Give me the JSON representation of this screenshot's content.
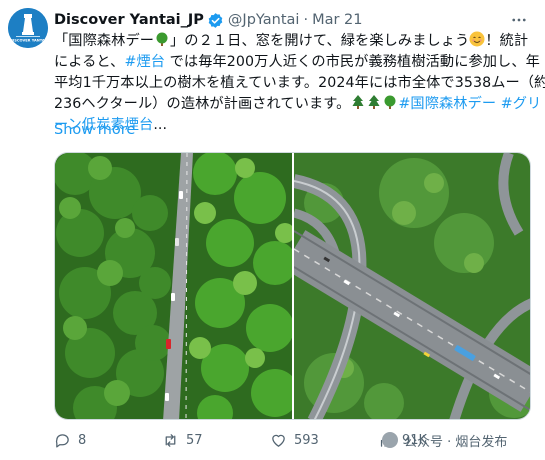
{
  "tweet": {
    "display_name": "Discover Yantai_JP",
    "handle": "@JpYantai",
    "separator": "·",
    "time": "Mar 21",
    "avatar_label": "DISCOVER YANTAI",
    "lines": [
      [
        "「国際森林デー",
        "」の２１日、窓を開けて、緑を楽しみましょう",
        "！統計"
      ],
      [
        "によると、",
        "#煙台",
        " では毎年200万人近くの市民が義務植樹活動に参加し、年"
      ],
      [
        "平均1千万本以上の樹木を植えています。2024年には市全体で3538ムー（約"
      ],
      [
        "236ヘクタール）の造林が計画されています。",
        "#国際森林デー",
        " ",
        "#グリ"
      ],
      [
        "ーン低炭素煙台",
        "..."
      ]
    ],
    "show_more": "Show more",
    "images": [
      {
        "name": "forest-road-photo"
      },
      {
        "name": "highway-interchange-photo"
      }
    ],
    "stats": {
      "replies": "8",
      "reposts": "57",
      "likes": "593",
      "views": "91K"
    },
    "watermark": "公众号 · 烟台发布"
  },
  "colors": {
    "link": "#1d9bf0",
    "text": "#0f1419",
    "muted": "#536471",
    "verified": "#1d9bf0",
    "avatar_bg": "#1d7fc4"
  },
  "icons": {
    "verified": "verified-badge-icon",
    "more": "more-horizontal-icon",
    "reply": "reply-icon",
    "repost": "repost-icon",
    "like": "heart-icon",
    "views": "views-icon"
  }
}
